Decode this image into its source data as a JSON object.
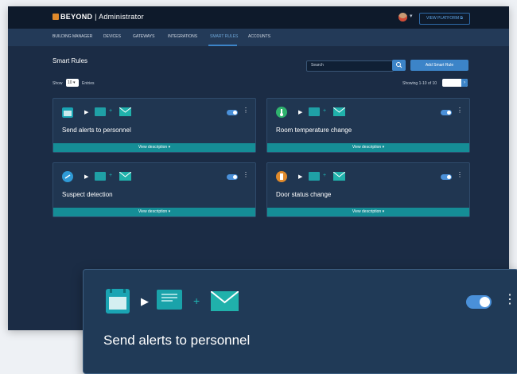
{
  "app": {
    "brand": "BEYOND",
    "role": "Administrator",
    "view_platform": "VIEW PLATFORM"
  },
  "nav": {
    "items": [
      "BUILDING MANAGER",
      "DEVICES",
      "GATEWAYS",
      "INTEGRATIONS",
      "SMART RULES",
      "ACCOUNTS"
    ],
    "active_index": 4
  },
  "page": {
    "title": "Smart Rules",
    "search_placeholder": "Search",
    "add_button": "Add Smart Rule",
    "show_label": "Show",
    "show_value": "10",
    "entries_label": "Entries",
    "showing": "Showing 1-10 of 10"
  },
  "rules": [
    {
      "title": "Send alerts to personnel",
      "trigger_icon": "calendar-icon",
      "trigger_color": "#1aa4b3",
      "enabled": true,
      "desc": "View description"
    },
    {
      "title": "Room temperature change",
      "trigger_icon": "thermometer-icon",
      "trigger_color": "#2fb36e",
      "enabled": true,
      "desc": "View description"
    },
    {
      "title": "Suspect detection",
      "trigger_icon": "motion-icon",
      "trigger_color": "#2f9ad6",
      "enabled": true,
      "desc": "View description"
    },
    {
      "title": "Door status change",
      "trigger_icon": "door-icon",
      "trigger_color": "#e08a2b",
      "enabled": true,
      "desc": "View description"
    }
  ],
  "zoom": {
    "title": "Send alerts to personnel",
    "trigger_icon": "calendar-icon",
    "enabled": true
  },
  "colors": {
    "accent": "#3c84c8",
    "teal": "#158d96",
    "panel": "#1b2c45"
  }
}
